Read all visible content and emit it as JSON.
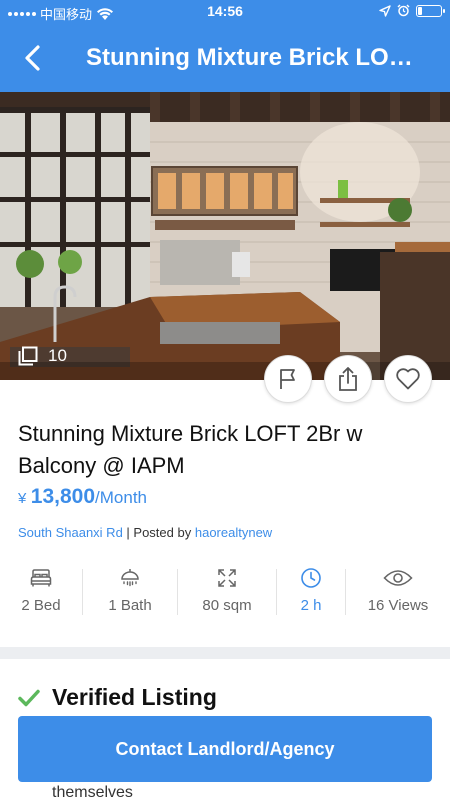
{
  "status_bar": {
    "carrier": "中国移动",
    "time": "14:56"
  },
  "nav": {
    "title": "Stunning Mixture Brick LOF…"
  },
  "photo": {
    "count": "10"
  },
  "listing": {
    "title": "Stunning Mixture Brick LOFT 2Br w Balcony @ IAPM",
    "currency": "¥",
    "price": "13,800",
    "period": "/Month",
    "location": "South Shaanxi Rd",
    "posted_prefix": "| Posted by",
    "poster": "haorealtynew"
  },
  "stats": [
    {
      "icon": "bed-icon",
      "label": "2 Bed"
    },
    {
      "icon": "shower-icon",
      "label": "1 Bath"
    },
    {
      "icon": "expand-icon",
      "label": "80 sqm"
    },
    {
      "icon": "clock-icon",
      "label": "2 h"
    },
    {
      "icon": "eye-icon",
      "label": "16 Views"
    }
  ],
  "verified": {
    "label": "Verified Listing"
  },
  "behind_text": "themselves",
  "cta": {
    "label": "Contact Landlord/Agency"
  },
  "colors": {
    "accent": "#3d8de8",
    "verified_check": "#5cb85c"
  }
}
